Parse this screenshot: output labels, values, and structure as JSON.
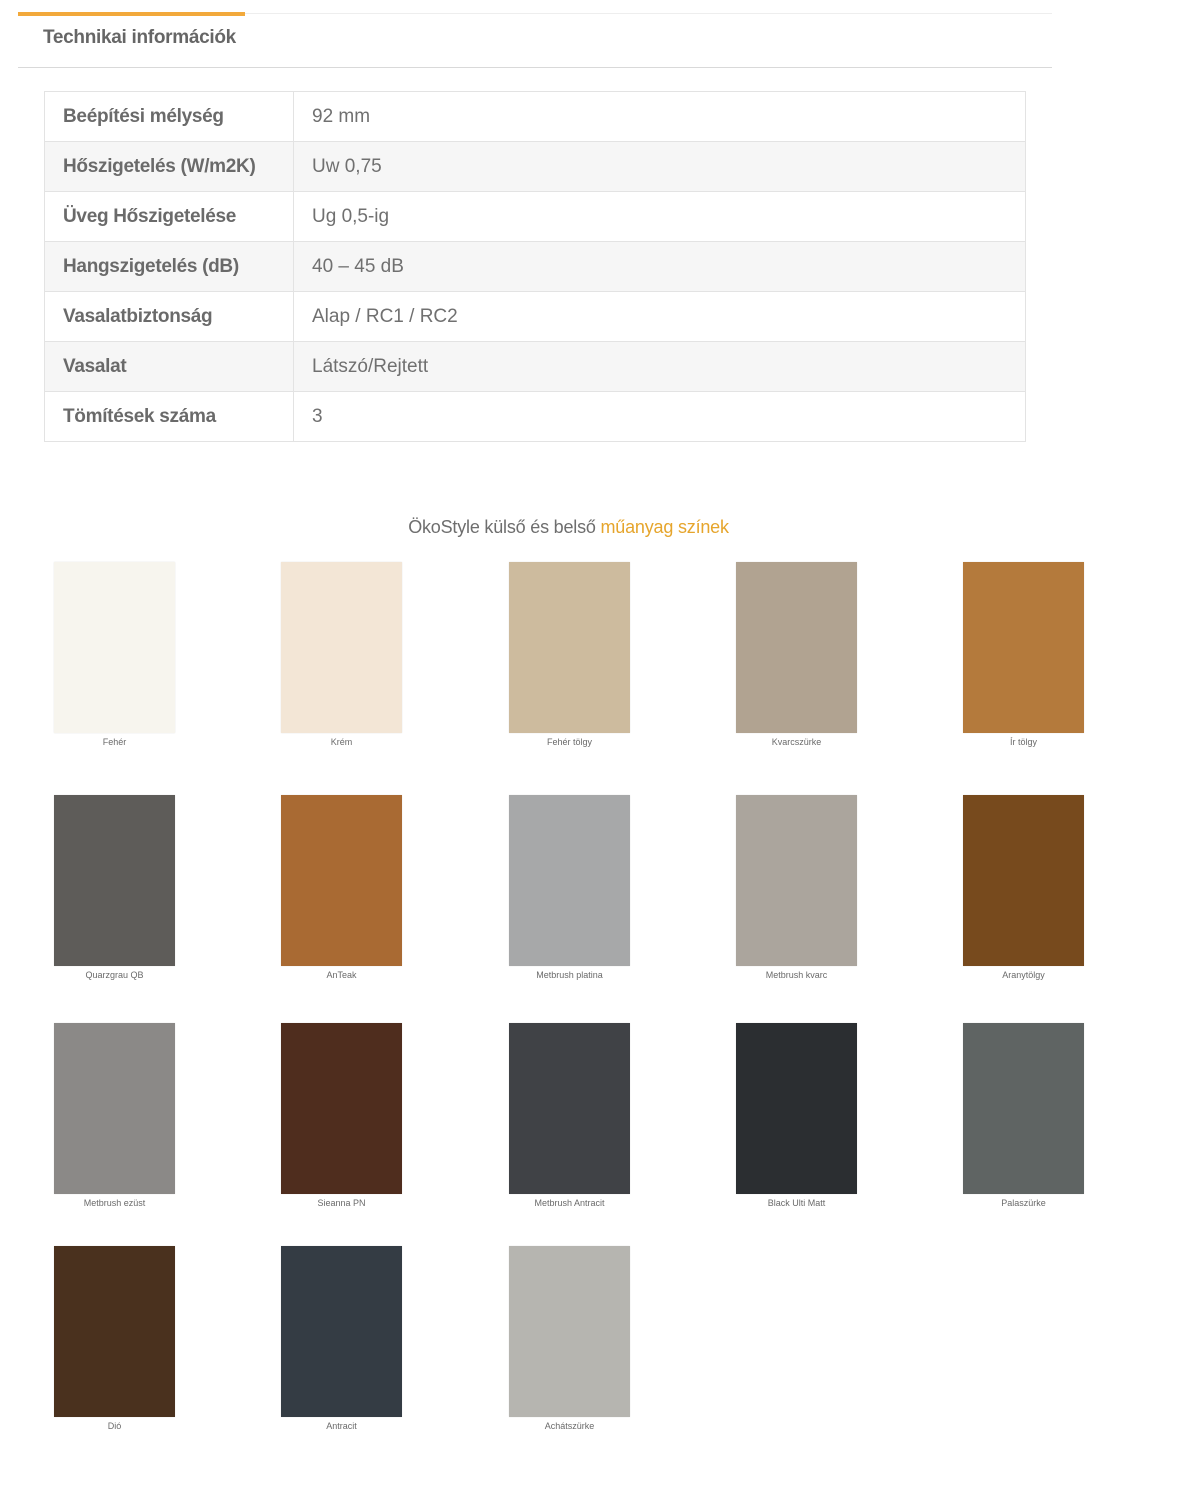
{
  "tabs": {
    "active_label": "Technikai információk",
    "accent_color": "#f2a93b"
  },
  "specs": [
    {
      "label": "Beépítési mélység",
      "value": "92 mm"
    },
    {
      "label": "Hőszigetelés (W/m2K)",
      "value": "Uw 0,75"
    },
    {
      "label": "Üveg Hőszigetelése",
      "value": "Ug 0,5-ig"
    },
    {
      "label": "Hangszigetelés (dB)",
      "value": "40 – 45 dB"
    },
    {
      "label": "Vasalatbiztonság",
      "value": "Alap / RC1 / RC2"
    },
    {
      "label": "Vasalat",
      "value": "Látszó/Rejtett"
    },
    {
      "label": "Tömítések száma",
      "value": "3"
    }
  ],
  "colors_section": {
    "title_prefix": "ÖkoStyle külső és belső",
    "title_highlight": "műanyag színek",
    "highlight_color": "#e6a52c"
  },
  "swatches": [
    {
      "name": "Fehér",
      "color": "#f7f5ee"
    },
    {
      "name": "Krém",
      "color": "#f3e6d6"
    },
    {
      "name": "Fehér tölgy",
      "color": "#cdbb9e"
    },
    {
      "name": "Kvarcszürke",
      "color": "#b1a391"
    },
    {
      "name": "Ír tölgy",
      "color": "#b47a3c"
    },
    {
      "name": "Quarzgrau QB",
      "color": "#5e5c59"
    },
    {
      "name": "AnTeak",
      "color": "#a96a33"
    },
    {
      "name": "Metbrush platina",
      "color": "#a7a8a9"
    },
    {
      "name": "Metbrush kvarc",
      "color": "#aba59d"
    },
    {
      "name": "Aranytölgy",
      "color": "#774a1d"
    },
    {
      "name": "Metbrush ezüst",
      "color": "#8b8987"
    },
    {
      "name": "Sieanna PN",
      "color": "#4f2d1e"
    },
    {
      "name": "Metbrush Antracit",
      "color": "#404246"
    },
    {
      "name": "Black Ulti Matt",
      "color": "#2b2e31"
    },
    {
      "name": "Palaszürke",
      "color": "#5f6463"
    },
    {
      "name": "Dió",
      "color": "#4a311e"
    },
    {
      "name": "Antracit",
      "color": "#343c44"
    },
    {
      "name": "Achátszürke",
      "color": "#b6b5b0"
    }
  ]
}
